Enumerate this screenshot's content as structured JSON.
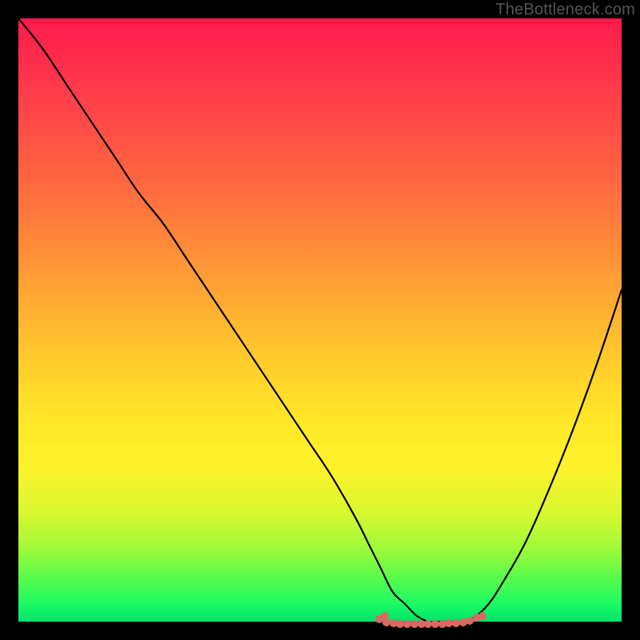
{
  "watermark": "TheBottleneck.com",
  "colors": {
    "frame": "#000000",
    "curve": "#000000",
    "marker": "#d86a63",
    "gradient_top": "#ff1a4b",
    "gradient_bottom": "#00e36a"
  },
  "chart_data": {
    "type": "line",
    "title": "",
    "xlabel": "",
    "ylabel": "",
    "xlim": [
      0,
      100
    ],
    "ylim": [
      0,
      100
    ],
    "grid": false,
    "legend": false,
    "series": [
      {
        "name": "bottleneck-curve",
        "x": [
          0,
          4,
          8,
          12,
          16,
          20,
          24,
          28,
          32,
          36,
          40,
          44,
          48,
          52,
          56,
          58,
          60,
          62,
          64,
          66,
          68,
          70,
          72,
          74,
          76,
          78,
          80,
          84,
          88,
          92,
          96,
          100
        ],
        "values": [
          100,
          95,
          89,
          83,
          77,
          71,
          66,
          60,
          54,
          48,
          42,
          36,
          30,
          24,
          17,
          13,
          9,
          5,
          3,
          1,
          0,
          0,
          0,
          0,
          1,
          3,
          6,
          13,
          22,
          32,
          43,
          55
        ]
      }
    ],
    "annotations": [
      {
        "name": "minimum-band",
        "x_start": 60,
        "x_end": 76,
        "y": 0
      }
    ]
  }
}
